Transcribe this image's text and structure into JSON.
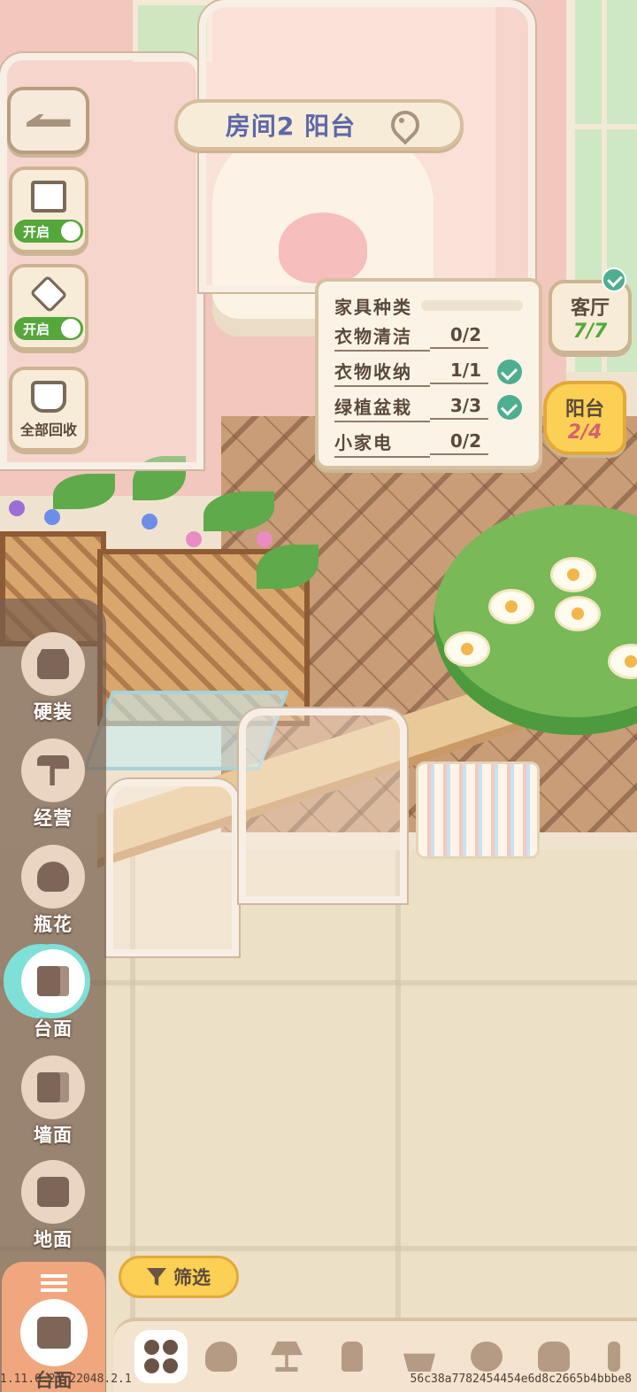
{
  "header": {
    "room_title": "房间2 阳台"
  },
  "side_controls": {
    "wall_toggle_label": "开启",
    "object_toggle_label": "开启",
    "recycle_all_label": "全部回收"
  },
  "furniture_panel": {
    "title": "家具种类",
    "rows": [
      {
        "name": "衣物清洁",
        "count": "0/2",
        "done": false
      },
      {
        "name": "衣物收纳",
        "count": "1/1",
        "done": true
      },
      {
        "name": "绿植盆栽",
        "count": "3/3",
        "done": true
      },
      {
        "name": "小家电",
        "count": "0/2",
        "done": false
      }
    ]
  },
  "room_tabs": [
    {
      "name": "客厅",
      "progress": "7/7",
      "complete": true
    },
    {
      "name": "阳台",
      "progress": "2/4",
      "active": true
    }
  ],
  "category_rail": [
    {
      "label": "硬装",
      "icon": "shop-icon"
    },
    {
      "label": "经营",
      "icon": "roller-icon"
    },
    {
      "label": "瓶花",
      "icon": "vase-icon"
    },
    {
      "label": "台面",
      "icon": "counter-icon",
      "active": true
    },
    {
      "label": "墙面",
      "icon": "wall-shelf-icon"
    },
    {
      "label": "地面",
      "icon": "sofa-icon"
    }
  ],
  "bottom_left": {
    "selected_label": "台面"
  },
  "filter_label": "筛选",
  "bottom_tabs": [
    "grid-icon",
    "teddy-bear-icon",
    "lamp-icon",
    "bottle-icon",
    "plant-pot-icon",
    "pig-icon",
    "teapot-icon",
    "cactus-icon"
  ],
  "footer": {
    "version": "1.11.0.21.22048.2.1",
    "hash": "56c38a7782454454e6d8c2665b4bbbe8"
  },
  "colors": {
    "accent_yellow": "#fcd054",
    "check_green": "#4fae8f",
    "title_blue": "#5d67a8",
    "rail_active": "#7fe0d8"
  }
}
